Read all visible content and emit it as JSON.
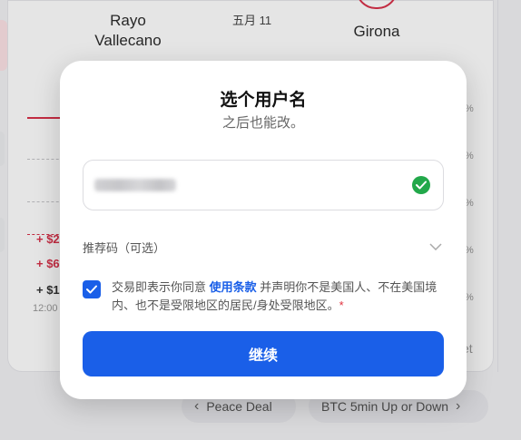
{
  "background": {
    "home_team": "Rayo Vallecano",
    "away_team": "Girona",
    "match_date": "五月 11",
    "price_labels": [
      "+ $2",
      "+ $6",
      "+ $1"
    ],
    "axis_time": "12:00",
    "pct_glyph": "%",
    "et_text": "et",
    "nav_prev": "Peace Deal",
    "nav_next": "BTC 5min Up or Down"
  },
  "modal": {
    "title": "选个用户名",
    "subtitle": "之后也能改。",
    "username_value": "",
    "referral_label": "推荐码（可选）",
    "terms_prefix": "交易即表示你同意 ",
    "terms_link": "使用条款",
    "terms_suffix": " 并声明你不是美国人、不在美国境内、也不是受限地区的居民/身处受限地区。",
    "terms_asterisk": "*",
    "terms_checked": true,
    "continue_label": "继续"
  },
  "colors": {
    "accent": "#1a5fe8",
    "success": "#22a84a",
    "danger": "#e0313d"
  }
}
